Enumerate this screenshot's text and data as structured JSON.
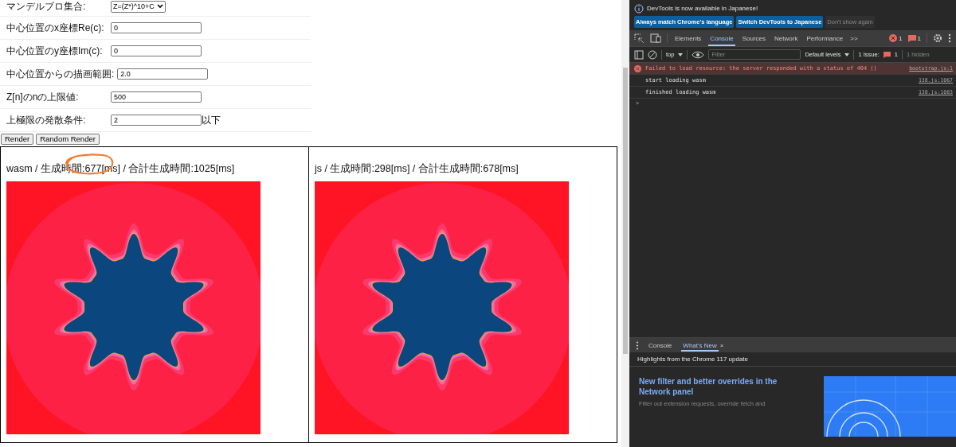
{
  "form": {
    "rows": [
      {
        "label": "マンデルブロ集合:",
        "kind": "select",
        "value": "Z=(Z*)^10+C"
      },
      {
        "label": "中心位置のx座標Re(c):",
        "kind": "input",
        "value": "0"
      },
      {
        "label": "中心位置のy座標Im(c):",
        "kind": "input",
        "value": "0"
      },
      {
        "label": "中心位置からの描画範囲:",
        "kind": "input",
        "value": "2.0"
      },
      {
        "label": "Z[n]のnの上限値:",
        "kind": "input",
        "value": "500"
      },
      {
        "label": "上極限の発散条件:",
        "kind": "input",
        "value": "2",
        "suffix": "以下"
      }
    ],
    "buttons": [
      "Render",
      "Random Render"
    ]
  },
  "panels": [
    {
      "caption": "wasm / 生成時間:677[ms] / 合計生成時間:1025[ms]",
      "annotated": true
    },
    {
      "caption": "js / 生成時間:298[ms] / 合計生成時間:678[ms]",
      "annotated": false
    }
  ],
  "devtools": {
    "notice": "DevTools is now available in Japanese!",
    "notice_buttons": [
      {
        "label": "Always match Chrome's language",
        "kind": "primary"
      },
      {
        "label": "Switch DevTools to Japanese",
        "kind": "primary"
      },
      {
        "label": "Don't show again",
        "kind": "plain"
      }
    ],
    "tabs": [
      {
        "label": "Elements",
        "selected": false
      },
      {
        "label": "Console",
        "selected": true
      },
      {
        "label": "Sources",
        "selected": false
      },
      {
        "label": "Network",
        "selected": false
      },
      {
        "label": "Performance",
        "selected": false
      }
    ],
    "more": ">>",
    "error_count": "1",
    "warning_count": "1",
    "console_toolbar": {
      "context": "top",
      "filter_placeholder": "Filter",
      "levels": "Default levels",
      "issues": "1 Issue:",
      "issues_count": "1",
      "hidden": "1 hidden"
    },
    "messages": [
      {
        "kind": "error",
        "text": "Failed to load resource: the server responded with a status of 404 ()",
        "source": "bootstrap.js:1"
      },
      {
        "kind": "log",
        "text": "start loading wasm",
        "source": "138.js:1067"
      },
      {
        "kind": "log",
        "text": "finished loading wasm",
        "source": "138.js:1083"
      }
    ],
    "prompt": ">",
    "drawer": {
      "tabs": [
        {
          "label": "Console",
          "selected": false,
          "closable": false
        },
        {
          "label": "What's New",
          "selected": true,
          "closable": true
        }
      ],
      "close": "×",
      "subtitle": "Highlights from the Chrome 117 update",
      "headline": "New filter and better overrides in the Network panel",
      "body": "Filter out extension requests, override fetch and"
    }
  }
}
